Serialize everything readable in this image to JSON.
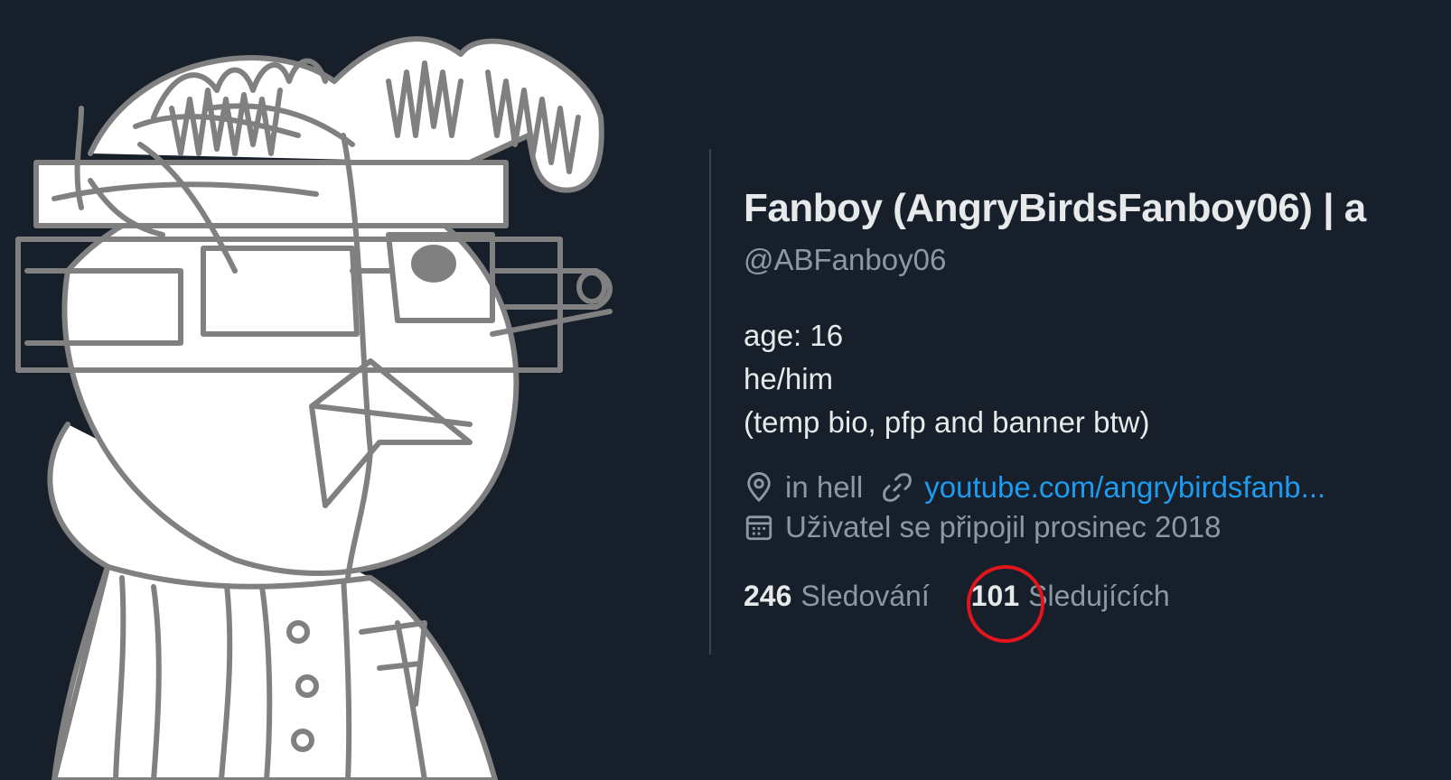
{
  "profile": {
    "display_name": "Fanboy (AngryBirdsFanboy06) | a",
    "handle": "@ABFanboy06",
    "bio_lines": [
      "age: 16",
      "he/him",
      "(temp bio, pfp and banner btw)"
    ],
    "location": "in hell",
    "website": "youtube.com/angrybirdsfanb...",
    "joined": "Uživatel se připojil prosinec 2018"
  },
  "stats": {
    "following_count": "246",
    "following_label": "Sledování",
    "followers_count": "101",
    "followers_label": "Sledujících"
  },
  "icons": {
    "location": "map-pin-icon",
    "website": "link-icon",
    "joined": "calendar-icon"
  },
  "colors": {
    "background": "#161f2a",
    "text_primary": "#e7e9ea",
    "text_secondary": "#8b98a5",
    "link": "#1d9bf0",
    "annotation": "#e3151c"
  }
}
